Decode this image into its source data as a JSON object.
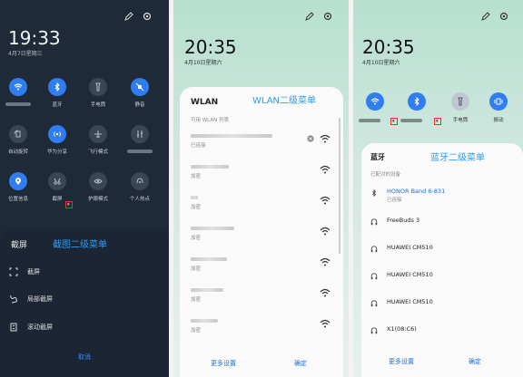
{
  "panel1": {
    "time": "19:33",
    "date": "4月7日星期三",
    "tiles": [
      {
        "label": "",
        "icon": "wifi-icon",
        "active": true
      },
      {
        "label": "蓝牙",
        "icon": "bluetooth-icon",
        "active": true
      },
      {
        "label": "手电筒",
        "icon": "flashlight-icon",
        "active": false
      },
      {
        "label": "静音",
        "icon": "bell-off-icon",
        "active": true
      },
      {
        "label": "自动旋转",
        "icon": "rotate-icon",
        "active": false
      },
      {
        "label": "华为分享",
        "icon": "share-wave-icon",
        "active": true
      },
      {
        "label": "飞行模式",
        "icon": "airplane-icon",
        "active": false
      },
      {
        "label": "",
        "icon": "sliders-icon",
        "active": false
      },
      {
        "label": "位置信息",
        "icon": "location-icon",
        "active": true
      },
      {
        "label": "截屏",
        "icon": "screenshot-icon",
        "active": false
      },
      {
        "label": "护眼模式",
        "icon": "eye-icon",
        "active": false
      },
      {
        "label": "个人热点",
        "icon": "hotspot-icon",
        "active": false
      }
    ],
    "sheet": {
      "title": "截屏",
      "annotation": "截图二级菜单",
      "items": [
        "截屏",
        "局部截屏",
        "滚动截屏"
      ],
      "cancel": "取消"
    }
  },
  "panel2": {
    "time": "20:35",
    "date": "4月10日星期六",
    "sheet": {
      "title": "WLAN",
      "annotation": "WLAN二级菜单",
      "list_header": "可用 WLAN 列表",
      "connected_status": "已连接",
      "encrypted_status": "加密",
      "more": "更多设置",
      "ok": "确定"
    }
  },
  "panel3": {
    "time": "20:35",
    "date": "4月10日星期六",
    "tiles": [
      {
        "label": "",
        "icon": "wifi-icon"
      },
      {
        "label": "",
        "icon": "bluetooth-icon"
      },
      {
        "label": "手电筒",
        "icon": "flashlight-icon"
      },
      {
        "label": "振动",
        "icon": "vibrate-icon"
      }
    ],
    "sheet": {
      "title": "蓝牙",
      "annotation": "蓝牙二级菜单",
      "paired_header": "已配对的设备",
      "devices": [
        {
          "name": "HONOR Band 6-831",
          "status": "已连接"
        },
        {
          "name": "FreeBuds 3",
          "status": ""
        },
        {
          "name": "HUAWEI CM510",
          "status": ""
        },
        {
          "name": "HUAWEI CM510",
          "status": ""
        },
        {
          "name": "HUAWEI CM510",
          "status": ""
        },
        {
          "name": "X1(08:C6)",
          "status": ""
        }
      ],
      "more": "更多设置",
      "ok": "确定"
    }
  }
}
